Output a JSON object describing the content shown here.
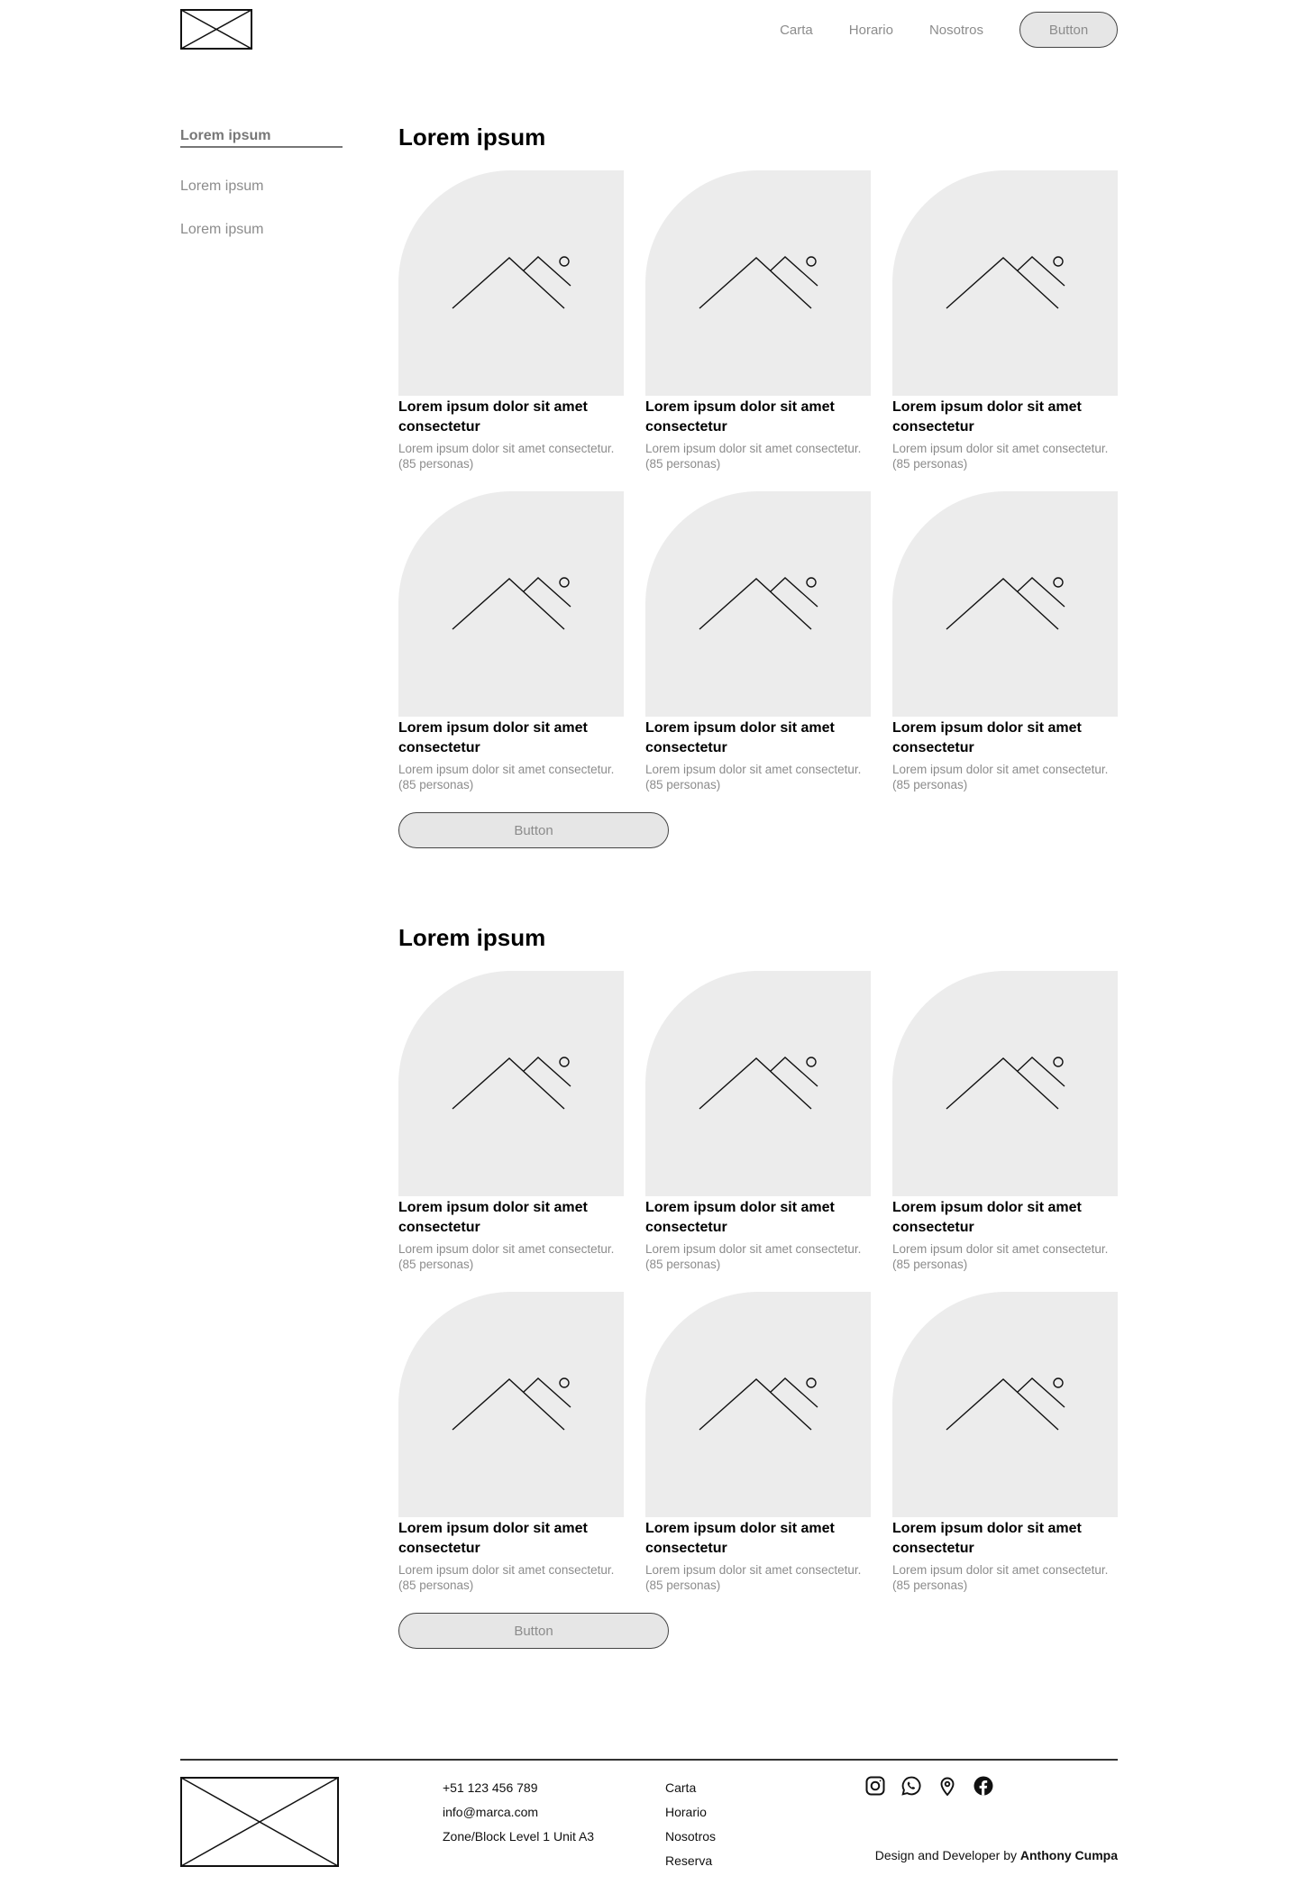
{
  "nav": {
    "links": [
      "Carta",
      "Horario",
      "Nosotros"
    ],
    "button": "Button"
  },
  "sidebar": {
    "items": [
      "Lorem ipsum",
      "Lorem ipsum",
      "Lorem ipsum"
    ]
  },
  "sections": [
    {
      "title": "Lorem ipsum",
      "button": "Button",
      "cards": [
        {
          "title": "Lorem ipsum dolor sit amet consectetur",
          "desc": "Lorem ipsum dolor sit amet consectetur. (85 personas)"
        },
        {
          "title": "Lorem ipsum dolor sit amet consectetur",
          "desc": "Lorem ipsum dolor sit amet consectetur. (85 personas)"
        },
        {
          "title": "Lorem ipsum dolor sit amet consectetur",
          "desc": "Lorem ipsum dolor sit amet consectetur. (85 personas)"
        },
        {
          "title": "Lorem ipsum dolor sit amet consectetur",
          "desc": "Lorem ipsum dolor sit amet consectetur. (85 personas)"
        },
        {
          "title": "Lorem ipsum dolor sit amet consectetur",
          "desc": "Lorem ipsum dolor sit amet consectetur. (85 personas)"
        },
        {
          "title": "Lorem ipsum dolor sit amet consectetur",
          "desc": "Lorem ipsum dolor sit amet consectetur. (85 personas)"
        }
      ]
    },
    {
      "title": "Lorem ipsum",
      "button": "Button",
      "cards": [
        {
          "title": "Lorem ipsum dolor sit amet consectetur",
          "desc": "Lorem ipsum dolor sit amet consectetur. (85 personas)"
        },
        {
          "title": "Lorem ipsum dolor sit amet consectetur",
          "desc": "Lorem ipsum dolor sit amet consectetur. (85 personas)"
        },
        {
          "title": "Lorem ipsum dolor sit amet consectetur",
          "desc": "Lorem ipsum dolor sit amet consectetur. (85 personas)"
        },
        {
          "title": "Lorem ipsum dolor sit amet consectetur",
          "desc": "Lorem ipsum dolor sit amet consectetur. (85 personas)"
        },
        {
          "title": "Lorem ipsum dolor sit amet consectetur",
          "desc": "Lorem ipsum dolor sit amet consectetur. (85 personas)"
        },
        {
          "title": "Lorem ipsum dolor sit amet consectetur",
          "desc": "Lorem ipsum dolor sit amet consectetur. (85 personas)"
        }
      ]
    }
  ],
  "footer": {
    "contact": [
      "+51 123 456 789",
      "info@marca.com",
      "Zone/Block Level 1 Unit A3"
    ],
    "links": [
      "Carta",
      "Horario",
      "Nosotros",
      "Reserva"
    ],
    "socials": [
      "instagram-icon",
      "whatsapp-icon",
      "location-pin-icon",
      "facebook-icon"
    ],
    "credit_prefix": "Design and Developer by",
    "credit_name": "Anthony Cumpa"
  },
  "colors": {
    "placeholder_bg": "#ececec",
    "muted_text": "#8c8c8c",
    "button_bg": "#e6e6e6"
  }
}
